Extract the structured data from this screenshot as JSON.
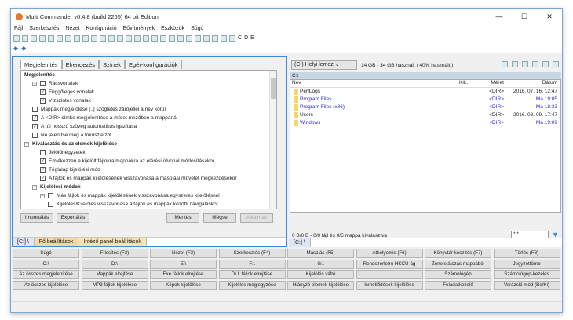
{
  "window": {
    "title": "Multi Commander v6.4.8 (build 2265) 64 bit Edition",
    "minimize": "—",
    "maximize": "☐",
    "close": "✕"
  },
  "menu": [
    "Fájl",
    "Szerkesztés",
    "Nézet",
    "Konfiguráció",
    "Bővítmények",
    "Eszközök",
    "Súgó"
  ],
  "toolbar": {
    "drive_labels": [
      "C",
      "D",
      "E"
    ]
  },
  "left": {
    "tabs": [
      "Megjelenítés",
      "Elrendezés",
      "Színek",
      "Egér-konfigurációk"
    ],
    "rows": [
      {
        "t": "Megjelenítés",
        "type": "header",
        "indent": 0
      },
      {
        "t": "Rácsvonalak",
        "checked": false,
        "indent": 1,
        "exp": "−"
      },
      {
        "t": "Függőleges vonalak",
        "checked": true,
        "indent": 2
      },
      {
        "t": "Vízszintes vonalak",
        "checked": true,
        "indent": 2
      },
      {
        "t": "Mappák megjelölése [..] szögletes zárójellel a név körül",
        "checked": false,
        "indent": 1
      },
      {
        "t": "A <DIR> címke megjelenítése a méret mezőben a mappánál",
        "checked": true,
        "indent": 1
      },
      {
        "t": "A túl hosszú szöveg automatikus igazítása",
        "checked": true,
        "indent": 1
      },
      {
        "t": "Ne jelenítse meg a fókuszjelzőt",
        "checked": false,
        "indent": 1
      },
      {
        "t": "Kiválasztás és az elemek kijelölése",
        "type": "header",
        "indent": 0,
        "exp": "−"
      },
      {
        "t": "Jelölőnégyzetek",
        "checked": false,
        "indent": 2
      },
      {
        "t": "Emlékezzen a kijelölt fájlokra/mappákra az elérési útvonal módosításakor",
        "checked": true,
        "indent": 2
      },
      {
        "t": "Téglalap kijelölési mód",
        "checked": true,
        "indent": 2
      },
      {
        "t": "A fájlok és mappák kijelölésének visszavonása a másolási művelet megkezdésekor",
        "checked": true,
        "indent": 2
      },
      {
        "t": "Kijelölési módok",
        "type": "header",
        "indent": 1,
        "exp": "−"
      },
      {
        "t": "Más fájlok és mappák kijelölésének visszavonása egyszeres kijelölésnél",
        "checked": false,
        "indent": 2,
        "exp": "−"
      },
      {
        "t": "Kijelölés/Kijelölés visszavonása a fájlok és mappák közötti navigáláskor",
        "checked": false,
        "indent": 3
      }
    ],
    "buttons": {
      "import": "Importálás",
      "export": "Exportálás",
      "save": "Mentés",
      "cancel": "Mégse",
      "apply": "Alkalmaz"
    },
    "panel_tabs": [
      "[C:] \\",
      "Fő beállítások",
      "Intéző panel beállítások"
    ]
  },
  "right": {
    "drive": "(C:) Helyi lemez",
    "space": "14 GB - 34 GB használt ( 40% használt )",
    "path": "C:\\",
    "columns": [
      "Név",
      "Kit...",
      "Méret",
      "Dátum"
    ],
    "files": [
      {
        "name": "PerfLogs",
        "size": "<DIR>",
        "date": "2016. 07. 16. 12:47",
        "blue": false
      },
      {
        "name": "Program Files",
        "size": "<DIR>",
        "date": "Ma 19:05",
        "blue": true
      },
      {
        "name": "Program Files (x86)",
        "size": "<DIR>",
        "date": "Ma 18:33",
        "blue": true
      },
      {
        "name": "Users",
        "size": "<DIR>",
        "date": "2016. 08. 09. 17:47",
        "blue": false
      },
      {
        "name": "Windows",
        "size": "<DIR>",
        "date": "Ma 19:09",
        "blue": true
      }
    ],
    "status": "0 B/0 B - 0/0 fájl és 0/5 mappa kiválasztva",
    "filter": "*.*",
    "tab": "[C:] \\"
  },
  "buttons": [
    [
      "Súgó",
      "Frissítés (F2)",
      "Nézet (F3)",
      "Szerkesztés (F4)",
      "Másolás (F5)",
      "Áthelyezés (F6)",
      "Könyvtár készítés (F7)",
      "Törlés (F8)"
    ],
    [
      "C:\\",
      "D:\\",
      "E:\\",
      "F:\\",
      "G:\\",
      "Rendszerleíró HKCU-ág",
      "Zenelejátszás mappából",
      "Jegyzettömb"
    ],
    [
      "Az összes megjelenítése",
      "Mappák elrejtése",
      "Exe fájlok elrejtése",
      "DLL fájlok elrejtése",
      "Kijelölés váltó",
      "",
      "Számológép",
      "Számológép-kezelés"
    ],
    [
      "Az összes kijelölése",
      "MP3 fájlok kijelölése",
      "Képek kijelölése",
      "Kijelölés megjegyzése",
      "Hiányzó elemek kijelölése",
      "Ismétlődések kijelölése",
      "Feladatkezelő",
      "Varázsló mód (Be/Ki)"
    ]
  ],
  "colors": {
    "accent": "#3b8ad6",
    "link": "#2a2ad0",
    "folder": "#f5d66a"
  }
}
